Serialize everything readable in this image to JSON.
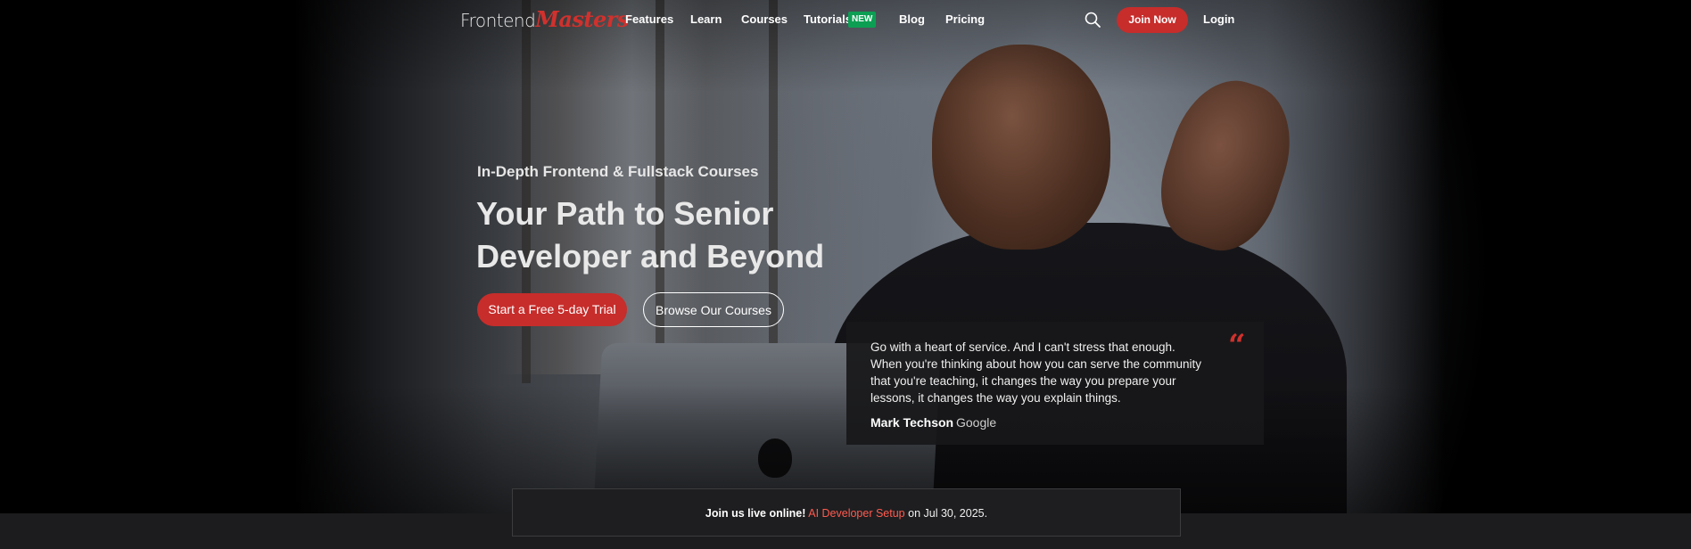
{
  "nav": {
    "logo_primary": "Frontend",
    "logo_secondary": "Masters",
    "links": [
      "Features",
      "Learn",
      "Courses",
      "Tutorials",
      "Blog",
      "Pricing"
    ],
    "tutorials_badge": "NEW",
    "search_icon": "search-icon",
    "join_label": "Join Now",
    "login_label": "Login"
  },
  "hero": {
    "eyebrow": "In-Depth Frontend & Fullstack Courses",
    "headline": "Your Path to Senior Developer and Beyond",
    "cta_primary": "Start a Free 5-day Trial",
    "cta_secondary": "Browse Our Courses"
  },
  "testimonial": {
    "quote": "Go with a heart of service. And I can't stress that enough. When you're thinking about how you can serve the community that you're teaching, it changes the way you prepare your lessons, it changes the way you explain things.",
    "quote_mark": "“",
    "author": "Mark Techson",
    "company": "Google"
  },
  "banner": {
    "lead": "Join us live online!",
    "event": "AI Developer Setup",
    "date_text": "on Jul 30, 2025."
  },
  "colors": {
    "accent": "#c62d2b",
    "badge_green": "#0c9f53",
    "link_red": "#ff5b4f"
  }
}
